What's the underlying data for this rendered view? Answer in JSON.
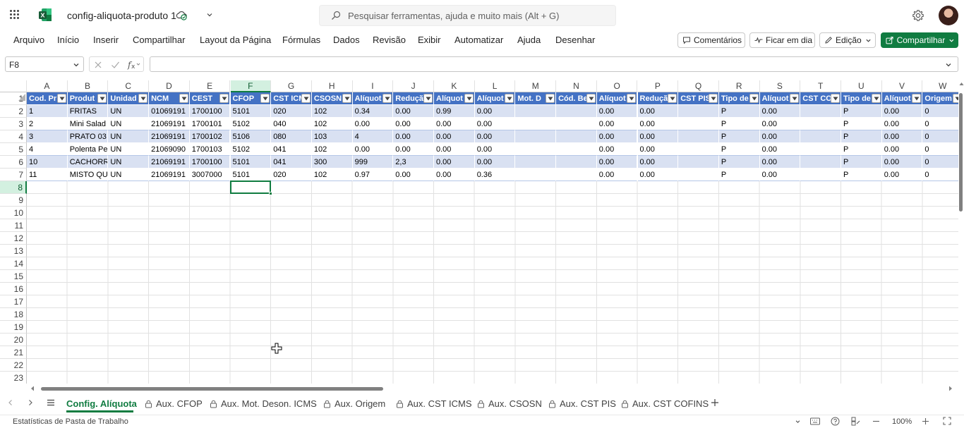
{
  "app": {
    "title": "config-aliquota-produto 1",
    "accent": "#107c41",
    "table_header_color": "#4472c4",
    "table_band_color": "#d9e1f2"
  },
  "search": {
    "placeholder": "Pesquisar ferramentas, ajuda e muito mais (Alt + G)"
  },
  "menu": [
    "Arquivo",
    "Início",
    "Inserir",
    "Compartilhar",
    "Layout da Página",
    "Fórmulas",
    "Dados",
    "Revisão",
    "Exibir",
    "Automatizar",
    "Ajuda",
    "Desenhar"
  ],
  "toolbar": {
    "comments": "Comentários",
    "meeting": "Ficar em dia",
    "editing": "Edição",
    "share": "Compartilhar"
  },
  "formula_bar": {
    "name_box": "F8",
    "formula": ""
  },
  "columns": [
    "A",
    "B",
    "C",
    "D",
    "E",
    "F",
    "G",
    "H",
    "I",
    "J",
    "K",
    "L",
    "M",
    "N",
    "O",
    "P",
    "Q",
    "R",
    "S",
    "T",
    "U",
    "V",
    "W"
  ],
  "selected": {
    "column": "F",
    "row": 8,
    "cell": "F8"
  },
  "row_numbers": [
    "1",
    "2",
    "3",
    "4",
    "5",
    "6",
    "7",
    "8",
    "9",
    "10",
    "11",
    "12",
    "13",
    "14",
    "15",
    "16",
    "17",
    "18",
    "19",
    "20",
    "21",
    "22",
    "23"
  ],
  "table": {
    "headers": [
      "Cod. Pr",
      "Produt",
      "Unidad",
      "NCM",
      "CEST",
      "CFOP",
      "CST ICM",
      "CSOSN",
      "Alíquot",
      "Reduçã",
      "Alíquot",
      "Alíquot",
      "Mot. D",
      "Cód. Be",
      "Alíquot",
      "Reduçã",
      "CST PIS",
      "Tipo de",
      "Alíquot",
      "CST CO",
      "Tipo de",
      "Alíquot",
      "Origem"
    ],
    "rows": [
      [
        "1",
        "FRITAS",
        "UN",
        "01069191",
        "1700100",
        "5101",
        "020",
        "102",
        "0.34",
        "0.00",
        "0.99",
        "0.00",
        "",
        "",
        "0.00",
        "0.00",
        "",
        "P",
        "0.00",
        "",
        "P",
        "0.00",
        "0"
      ],
      [
        "2",
        "Mini Salad",
        "UN",
        "21069191",
        "1700101",
        "5102",
        "040",
        "102",
        "0.00",
        "0.00",
        "0.00",
        "0.00",
        "",
        "",
        "0.00",
        "0.00",
        "",
        "P",
        "0.00",
        "",
        "P",
        "0.00",
        "0"
      ],
      [
        "3",
        "PRATO 03",
        "UN",
        "21069191",
        "1700102",
        "5106",
        "080",
        "103",
        "4",
        "0.00",
        "0.00",
        "0.00",
        "",
        "",
        "0.00",
        "0.00",
        "",
        "P",
        "0.00",
        "",
        "P",
        "0.00",
        "0"
      ],
      [
        "4",
        "Polenta Pe",
        "UN",
        "21069090",
        "1700103",
        "5102",
        "041",
        "102",
        "0.00",
        "0.00",
        "0.00",
        "0.00",
        "",
        "",
        "0.00",
        "0.00",
        "",
        "P",
        "0.00",
        "",
        "P",
        "0.00",
        "0"
      ],
      [
        "10",
        "CACHORRO",
        "UN",
        "21069191",
        "1700100",
        "5101",
        "041",
        "300",
        "999",
        "2,3",
        "0.00",
        "0.00",
        "",
        "",
        "0.00",
        "0.00",
        "",
        "P",
        "0.00",
        "",
        "P",
        "0.00",
        "0"
      ],
      [
        "11",
        "MISTO QU",
        "UN",
        "21069191",
        "3007000",
        "5101",
        "020",
        "102",
        "0.97",
        "0.00",
        "0.00",
        "0.36",
        "",
        "",
        "0.00",
        "0.00",
        "",
        "P",
        "0.00",
        "",
        "P",
        "0.00",
        "0"
      ]
    ]
  },
  "sheet_tabs": [
    "Config. Alíquota",
    "Aux. CFOP",
    "Aux. Mot. Deson. ICMS",
    "Aux. Origem",
    "Aux. CST ICMS",
    "Aux. CSOSN",
    "Aux. CST PIS",
    "Aux. CST COFINS"
  ],
  "status": {
    "text": "Estatísticas de Pasta de Trabalho",
    "zoom": "100%"
  }
}
